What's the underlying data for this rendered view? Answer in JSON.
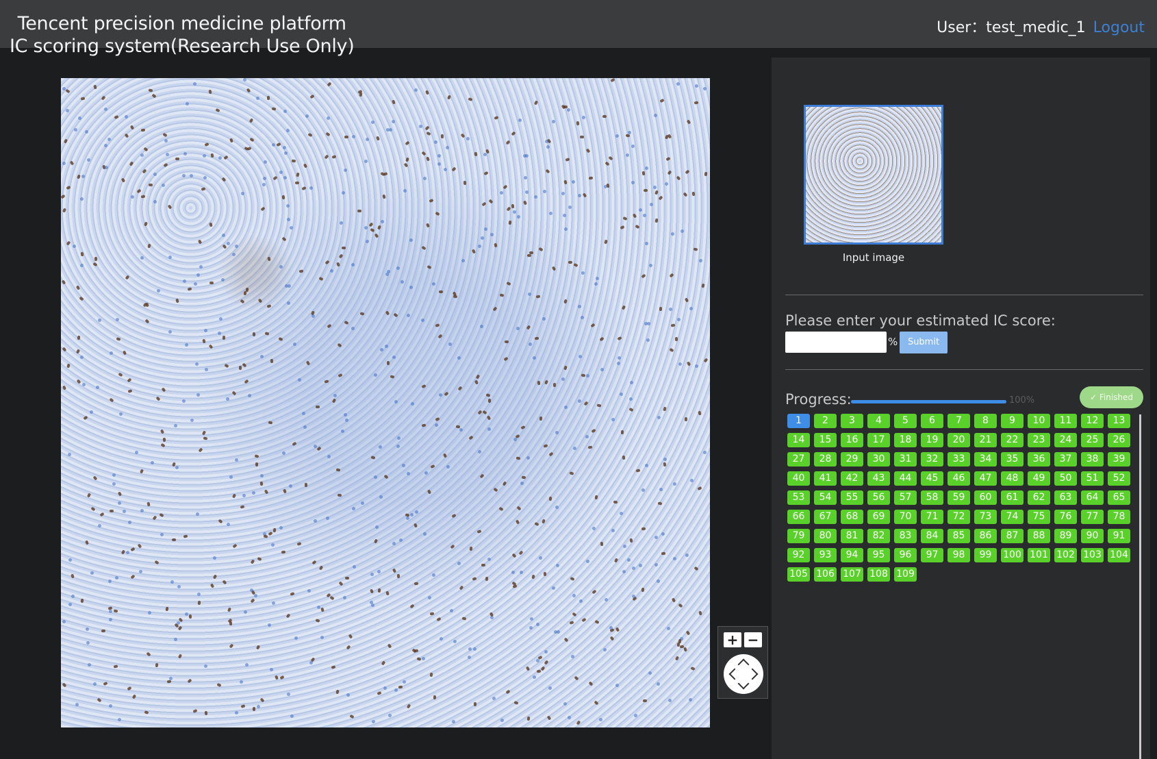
{
  "header": {
    "title_line1": "Tencent precision medicine platform",
    "title_line2": "IC scoring system(Research Use Only)",
    "user_label": "User：",
    "username": "test_medic_1",
    "logout_label": "Logout"
  },
  "viewer": {
    "zoom_in_label": "+",
    "zoom_out_label": "−"
  },
  "panel": {
    "thumbnail_label": "Input image",
    "score_prompt": "Please enter your estimated IC score:",
    "score_input_value": "",
    "percent_sign": "%",
    "submit_label": "Submit",
    "progress_label": "Progress:",
    "progress_value": 100,
    "progress_text": "100%",
    "finished_label": "✓ Finished",
    "current_case": 1,
    "cases": [
      "1",
      "2",
      "3",
      "4",
      "5",
      "6",
      "7",
      "8",
      "9",
      "10",
      "11",
      "12",
      "13",
      "14",
      "15",
      "16",
      "17",
      "18",
      "19",
      "20",
      "21",
      "22",
      "23",
      "24",
      "25",
      "26",
      "27",
      "28",
      "29",
      "30",
      "31",
      "32",
      "33",
      "34",
      "35",
      "36",
      "37",
      "38",
      "39",
      "40",
      "41",
      "42",
      "43",
      "44",
      "45",
      "46",
      "47",
      "48",
      "49",
      "50",
      "51",
      "52",
      "53",
      "54",
      "55",
      "56",
      "57",
      "58",
      "59",
      "60",
      "61",
      "62",
      "63",
      "64",
      "65",
      "66",
      "67",
      "68",
      "69",
      "70",
      "71",
      "72",
      "73",
      "74",
      "75",
      "76",
      "77",
      "78",
      "79",
      "80",
      "81",
      "82",
      "83",
      "84",
      "85",
      "86",
      "87",
      "88",
      "89",
      "90",
      "91",
      "92",
      "93",
      "94",
      "95",
      "96",
      "97",
      "98",
      "99",
      "100",
      "101",
      "102",
      "103",
      "104",
      "105",
      "106",
      "107",
      "108",
      "109"
    ]
  },
  "colors": {
    "header_bg": "#3b3c3e",
    "panel_bg": "#2a2b2d",
    "accent_blue": "#3e8ee8",
    "done_green": "#5ad12b",
    "logout_link": "#3e7fd1"
  }
}
